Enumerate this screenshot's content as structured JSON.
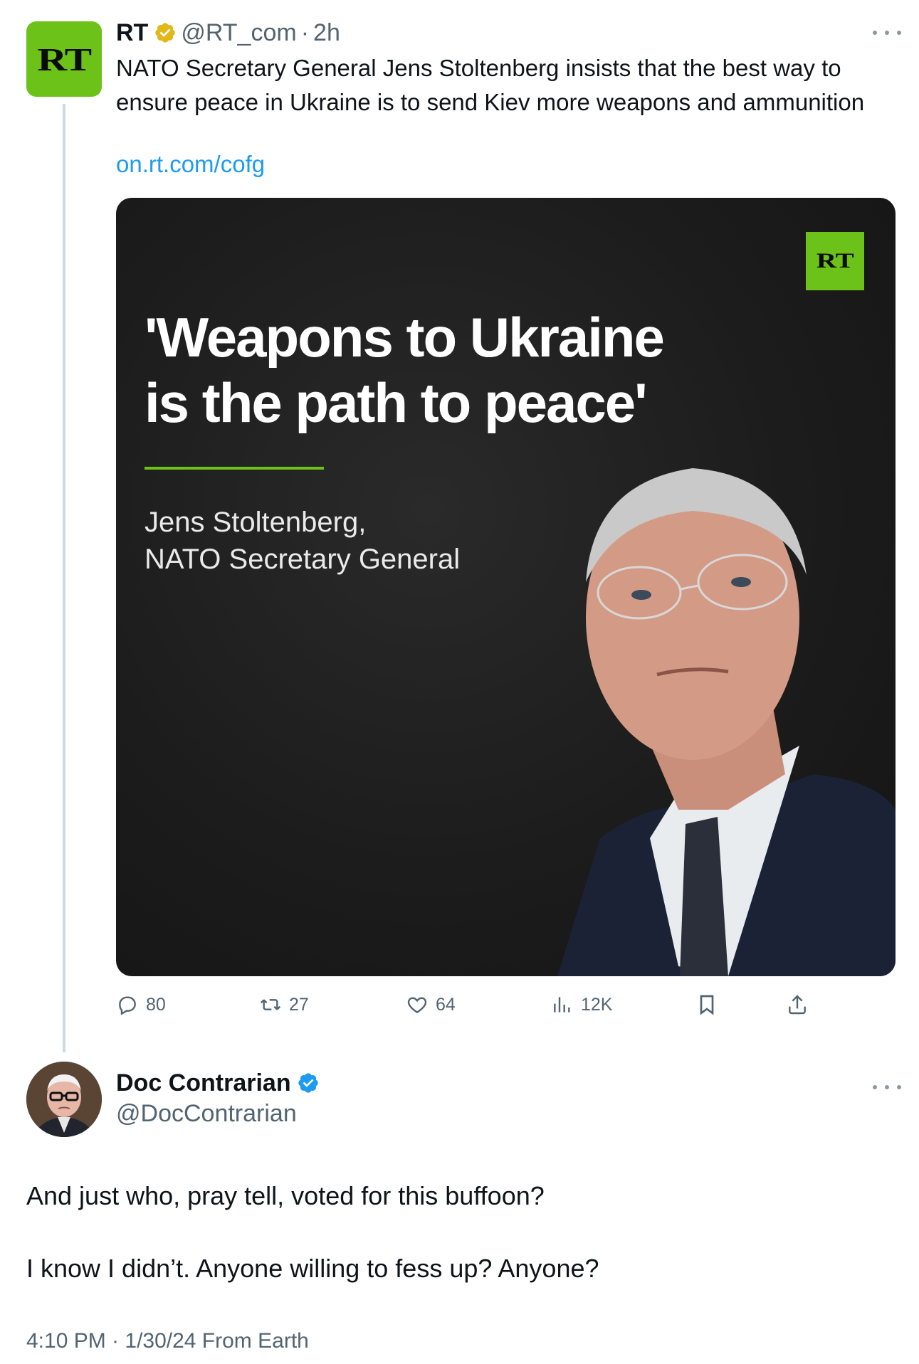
{
  "rt_tweet": {
    "avatar_text": "RT",
    "name": "RT",
    "handle": "@RT_com",
    "time": "2h",
    "text": "NATO Secretary General Jens Stoltenberg insists that the best way to ensure peace in Ukraine is to send Kiev more weapons and ammunition",
    "link": "on.rt.com/cofg",
    "media": {
      "logo_text": "RT",
      "quote_line1": "'Weapons to Ukraine",
      "quote_line2": "is the path to peace'",
      "attribution_line1": "Jens Stoltenberg,",
      "attribution_line2": "NATO Secretary General"
    },
    "actions": {
      "replies": "80",
      "retweets": "27",
      "likes": "64",
      "views": "12K"
    }
  },
  "reply_tweet": {
    "name": "Doc Contrarian",
    "handle": "@DocContrarian",
    "line1": "And just who, pray tell, voted for this buffoon?",
    "line2": "I know I didn’t. Anyone willing to fess up? Anyone?",
    "meta": "4:10 PM · 1/30/24 From Earth"
  },
  "colors": {
    "rt_green": "#6cc218",
    "link_blue": "#1d9bf0",
    "gold_badge": "#e2b719",
    "blue_badge": "#1d9bf0",
    "secondary_text": "#536471"
  }
}
